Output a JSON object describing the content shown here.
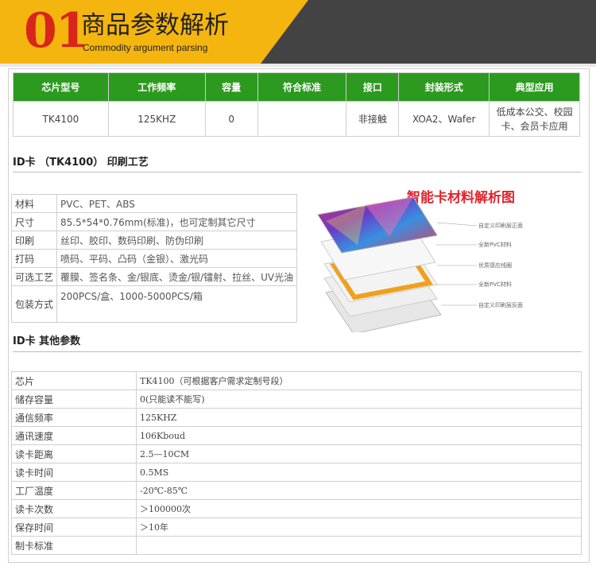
{
  "header": {
    "number": "01",
    "title": "商品参数解析",
    "subtitle": "Commodity argument parsing"
  },
  "spec_table": {
    "headers": [
      "芯片型号",
      "工作频率",
      "容量",
      "符合标准",
      "接口",
      "封装形式",
      "典型应用"
    ],
    "row": [
      "TK4100",
      "125KHZ",
      "0",
      "",
      "非接触",
      "XOA2、Wafer",
      "低成本公交、校园卡、会员卡应用"
    ]
  },
  "craft_section": {
    "title": "ID卡 （TK4100） 印刷工艺",
    "rows": [
      {
        "k": "材料",
        "v": "PVC、PET、ABS"
      },
      {
        "k": "尺寸",
        "v": "85.5*54*0.76mm(标准)，也可定制其它尺寸"
      },
      {
        "k": "印刷",
        "v": "丝印、胶印、数码印刷、防伪印刷"
      },
      {
        "k": "打码",
        "v": "喷码、平码、凸码（金银）、激光码"
      },
      {
        "k": "可选工艺",
        "v": "覆膜、签名条、金/银底、烫金/银/镭射、拉丝、UV光油"
      },
      {
        "k": "包装方式",
        "v": "200PCS/盒、1000-5000PCS/箱"
      }
    ]
  },
  "illustration": {
    "title": "智能卡材料解析图",
    "layers": [
      "自定义印刷层正面",
      "全新PVC材料",
      "优质感应线圈",
      "全新PVC材料",
      "自定义印刷层反面"
    ],
    "colors": {
      "accent_red": "#e0262f",
      "coil_orange": "#f0a020"
    }
  },
  "params_section": {
    "title": "ID卡 其他参数",
    "rows": [
      {
        "k": "芯片",
        "v": "TK4100（可根据客户需求定制号段）"
      },
      {
        "k": "储存容量",
        "v": "0(只能读不能写)"
      },
      {
        "k": "通信频率",
        "v": "125KHZ"
      },
      {
        "k": "通讯速度",
        "v": "106Kboud"
      },
      {
        "k": "读卡距离",
        "v": "2.5—10CM"
      },
      {
        "k": "读卡时间",
        "v": "0.5MS"
      },
      {
        "k": "工厂温度",
        "v": "-20℃-85℃"
      },
      {
        "k": "读卡次数",
        "v": "＞100000次"
      },
      {
        "k": "保存时间",
        "v": "＞10年"
      },
      {
        "k": "制卡标准",
        "v": ""
      }
    ]
  },
  "colors": {
    "banner_yellow": "#f5b50f",
    "banner_dark": "#434343",
    "number_red": "#d8261b",
    "table_green": "#2c9a1f"
  }
}
